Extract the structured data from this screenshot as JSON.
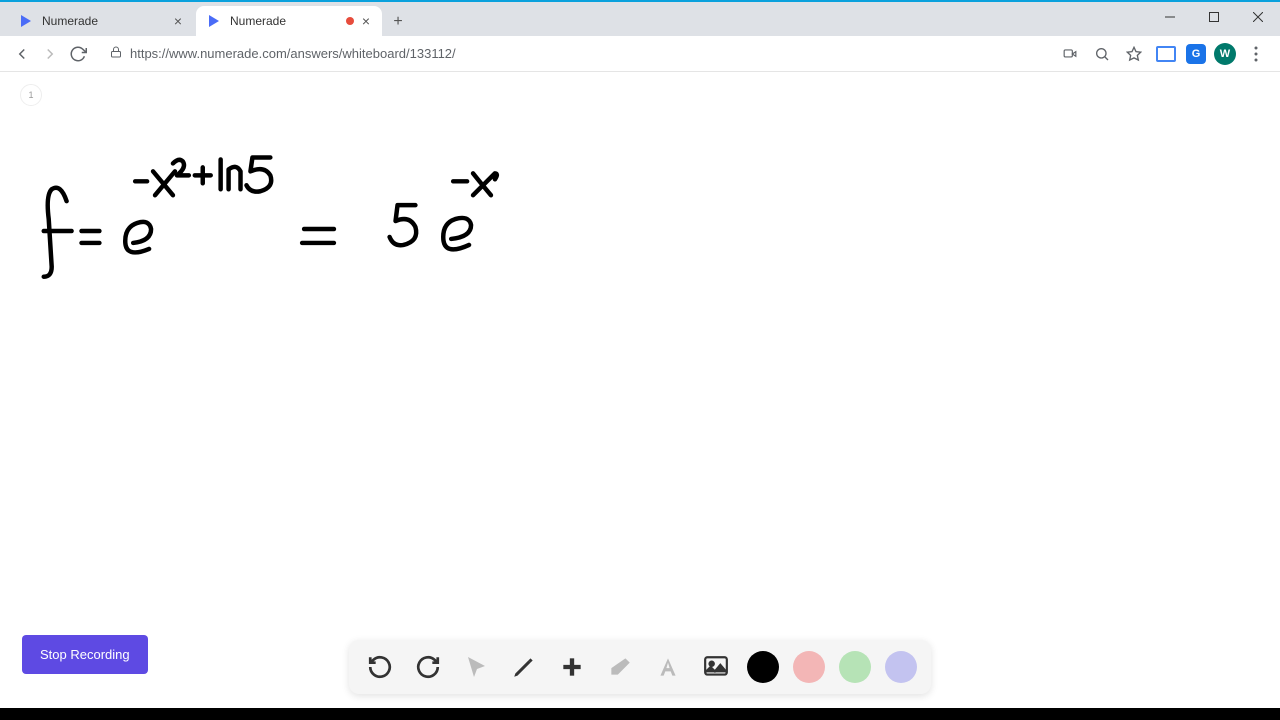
{
  "tabs": [
    {
      "title": "Numerade",
      "active": false
    },
    {
      "title": "Numerade",
      "active": true,
      "recording": true
    }
  ],
  "url": "https://www.numerade.com/answers/whiteboard/133112/",
  "page_number": "1",
  "stop_recording_label": "Stop Recording",
  "badges": {
    "g": "G",
    "w": "W"
  },
  "toolbar": {
    "colors": {
      "black": "#000000",
      "pink": "#f3b6b6",
      "green": "#b6e3b6",
      "purple": "#c3c3f0"
    }
  },
  "handwriting": {
    "description": "f = e^{-x^2 + ln 5} = 5 e^{-x}",
    "strokes_svg_viewbox": "0 0 1280 640"
  }
}
